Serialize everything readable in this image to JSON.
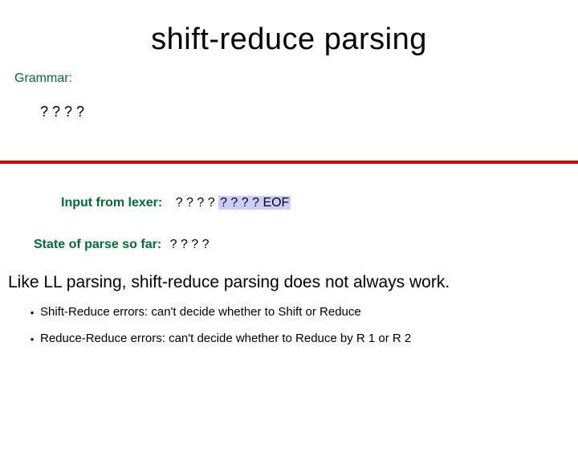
{
  "title": "shift-reduce parsing",
  "grammar": {
    "label": "Grammar:",
    "body": "? ? ? ?"
  },
  "lexer": {
    "label": "Input from lexer:",
    "prefix_unhl": "? ? ? ? ",
    "highlighted": "? ? ? ? EOF"
  },
  "state": {
    "label": "State of parse so far:",
    "value": "? ? ? ?"
  },
  "body_text": "Like LL parsing, shift-reduce parsing does not always work.",
  "bullets": [
    "Shift-Reduce errors: can't decide whether to Shift or Reduce",
    "Reduce-Reduce errors: can't decide whether to Reduce by R 1 or R 2"
  ]
}
